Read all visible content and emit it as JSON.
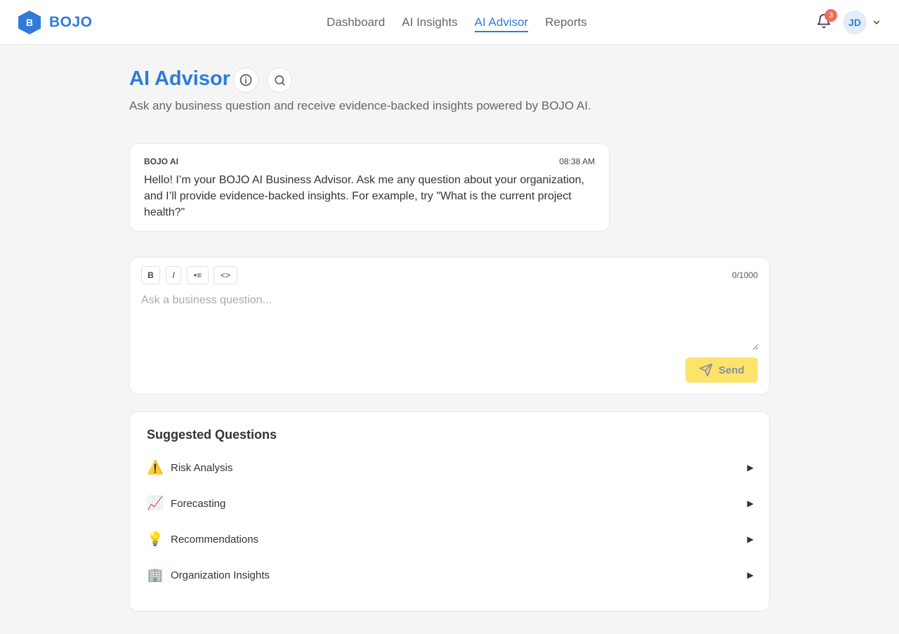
{
  "brand": {
    "logo_letter": "B",
    "name": "BOJO",
    "color": "#2f7bd9"
  },
  "nav": {
    "items": [
      {
        "label": "Dashboard",
        "active": false
      },
      {
        "label": "AI Insights",
        "active": false
      },
      {
        "label": "AI Advisor",
        "active": true
      },
      {
        "label": "Reports",
        "active": false
      }
    ]
  },
  "header": {
    "notification_count": "3",
    "user_initials": "JD"
  },
  "page": {
    "title": "AI Advisor",
    "subtitle": "Ask any business question and receive evidence-backed insights powered by BOJO AI."
  },
  "message": {
    "sender": "BOJO AI",
    "time": "08:38 AM",
    "text": "Hello! I’m your BOJO AI Business Advisor. Ask me any question about your organization, and I’ll provide evidence-backed insights. For example, try \"What is the current project health?\""
  },
  "composer": {
    "format_buttons": {
      "bold": "B",
      "italic": "I",
      "list": "•≡",
      "code": "<>"
    },
    "char_count": "0/1000",
    "placeholder": "Ask a business question...",
    "send_label": "Send",
    "send_color": "#fde36a"
  },
  "suggestions": {
    "title": "Suggested Questions",
    "items": [
      {
        "icon": "⚠️",
        "icon_name": "warning-icon",
        "label": "Risk Analysis"
      },
      {
        "icon": "📈",
        "icon_name": "chart-increasing-icon",
        "label": "Forecasting"
      },
      {
        "icon": "💡",
        "icon_name": "lightbulb-icon",
        "label": "Recommendations"
      },
      {
        "icon": "🏢",
        "icon_name": "office-building-icon",
        "label": "Organization Insights"
      }
    ],
    "arrow": "▶"
  }
}
